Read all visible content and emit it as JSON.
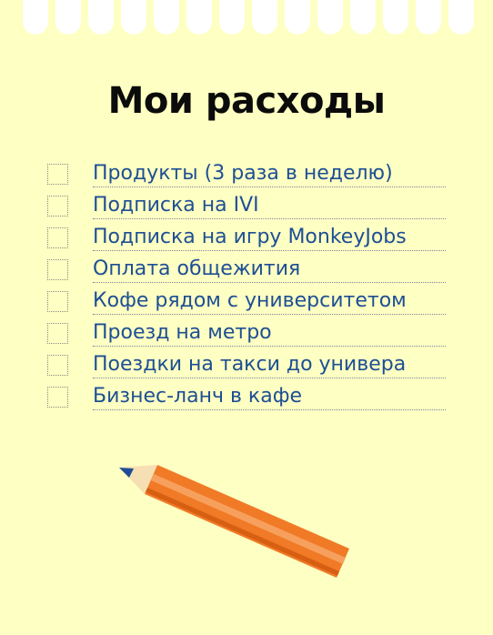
{
  "title": "Мои расходы",
  "items": [
    {
      "label": "Продукты (3 раза в неделю)"
    },
    {
      "label": "Подписка на IVI"
    },
    {
      "label": "Подписка на игру MonkeyJobs"
    },
    {
      "label": "Оплата общежития"
    },
    {
      "label": "Кофе рядом с университетом"
    },
    {
      "label": "Проезд на метро"
    },
    {
      "label": "Поездки на такси до универа"
    },
    {
      "label": "Бизнес-ланч в кафе"
    }
  ],
  "icons": {
    "pencil": "pencil-icon"
  },
  "colors": {
    "background": "#feffc2",
    "holes": "#ffffff",
    "title": "#0b0b0b",
    "item_text": "#1d4f95",
    "pencil_body": "#f07a26",
    "pencil_tip": "#1f4c99"
  }
}
